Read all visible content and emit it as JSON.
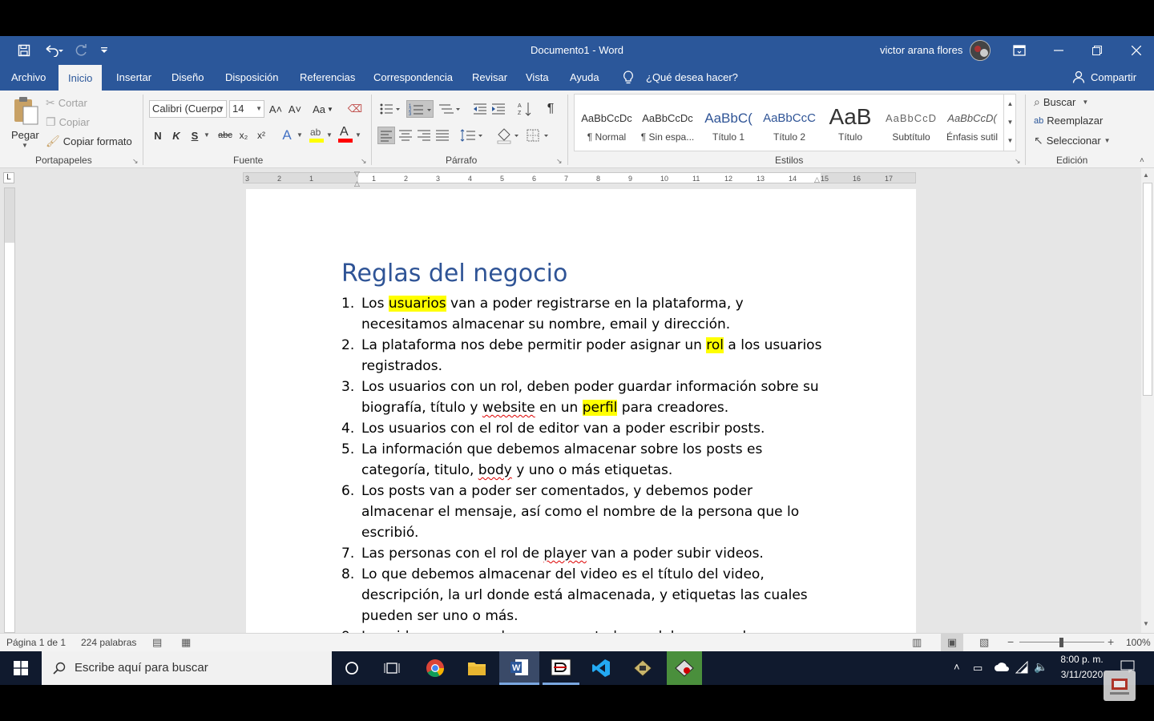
{
  "title_bar": {
    "title": "Documento1  -  Word",
    "user": "victor arana flores"
  },
  "tabs": [
    "Archivo",
    "Inicio",
    "Insertar",
    "Diseño",
    "Disposición",
    "Referencias",
    "Correspondencia",
    "Revisar",
    "Vista",
    "Ayuda"
  ],
  "tell_me": "¿Qué desea hacer?",
  "share": "Compartir",
  "clipboard": {
    "paste": "Pegar",
    "cut": "Cortar",
    "copy": "Copiar",
    "format_painter": "Copiar formato",
    "group": "Portapapeles"
  },
  "font": {
    "name": "Calibri (Cuerpo",
    "size": "14",
    "group": "Fuente",
    "bold": "N",
    "italic": "K",
    "underline": "S",
    "strike": "abc",
    "subscript": "x₂",
    "superscript": "x²",
    "grow": "A˄",
    "shrink": "A˅",
    "case": "Aa",
    "effects": "A",
    "font_color": "A",
    "highlight_color": "#ffff00",
    "font_color_value": "#ff0000"
  },
  "paragraph": {
    "group": "Párrafo"
  },
  "styles": {
    "group": "Estilos",
    "items": [
      {
        "sample": "AaBbCcDc",
        "name": "¶ Normal"
      },
      {
        "sample": "AaBbCcDc",
        "name": "¶ Sin espa..."
      },
      {
        "sample": "AaBbC(",
        "name": "Título 1"
      },
      {
        "sample": "AaBbCcC",
        "name": "Título 2"
      },
      {
        "sample": "AaB",
        "name": "Título"
      },
      {
        "sample": "AaBbCcD",
        "name": "Subtítulo"
      },
      {
        "sample": "AaBbCcD(",
        "name": "Énfasis sutil"
      }
    ]
  },
  "editing": {
    "group": "Edición",
    "find": "Buscar",
    "replace": "Reemplazar",
    "select": "Seleccionar"
  },
  "ruler": {
    "numbers": [
      "3",
      "2",
      "1",
      "1",
      "2",
      "3",
      "4",
      "5",
      "6",
      "7",
      "8",
      "9",
      "10",
      "11",
      "12",
      "13",
      "14",
      "15",
      "16",
      "17"
    ]
  },
  "document": {
    "heading": "Reglas del negocio",
    "items": [
      {
        "n": "1.",
        "parts": [
          {
            "t": "Los "
          },
          {
            "t": "usuarios",
            "hl": true
          },
          {
            "t": " van a poder registrarse en la plataforma, y necesitamos almacenar su nombre, email y dirección."
          }
        ]
      },
      {
        "n": "2.",
        "parts": [
          {
            "t": "La plataforma nos debe permitir poder asignar un "
          },
          {
            "t": "rol",
            "hl": true
          },
          {
            "t": " a los usuarios registrados."
          }
        ]
      },
      {
        "n": "3.",
        "parts": [
          {
            "t": "Los usuarios con un rol, deben poder guardar información sobre su biografía, título y "
          },
          {
            "t": "website",
            "sq": true
          },
          {
            "t": " en un "
          },
          {
            "t": "perfil",
            "hl": true
          },
          {
            "t": " para creadores."
          }
        ]
      },
      {
        "n": "4.",
        "parts": [
          {
            "t": "Los usuarios con el rol de editor van a poder escribir posts."
          }
        ]
      },
      {
        "n": "5.",
        "parts": [
          {
            "t": "La información que debemos almacenar sobre los posts es categoría, titulo, "
          },
          {
            "t": "body",
            "sq": true
          },
          {
            "t": " y uno o más etiquetas."
          }
        ]
      },
      {
        "n": "6.",
        "parts": [
          {
            "t": "Los posts van a poder ser comentados, y debemos poder almacenar el mensaje, así como el nombre de la persona que lo escribió."
          }
        ]
      },
      {
        "n": "7.",
        "parts": [
          {
            "t": "Las personas con el rol de "
          },
          {
            "t": "player",
            "sq": true
          },
          {
            "t": " van a poder subir videos."
          }
        ]
      },
      {
        "n": "8.",
        "parts": [
          {
            "t": "Lo que debemos almacenar del video es el título del video, descripción, la url donde está almacenada, y etiquetas las cuales pueden ser uno o más."
          }
        ]
      },
      {
        "n": "9.",
        "parts": [
          {
            "t": "Los videos van a poder ser comentados, y debemos poder almacenar"
          }
        ]
      }
    ]
  },
  "status": {
    "page": "Página 1 de 1",
    "words": "224 palabras",
    "zoom": "100%",
    "zoom_minus": "−",
    "zoom_plus": "+"
  },
  "taskbar": {
    "search_placeholder": "Escribe aquí para buscar",
    "time": "8:00 p. m.",
    "date": "3/11/2020"
  },
  "colors": {
    "word_blue": "#2b579a",
    "heading": "#2f5496",
    "highlight": "#ffff00"
  }
}
